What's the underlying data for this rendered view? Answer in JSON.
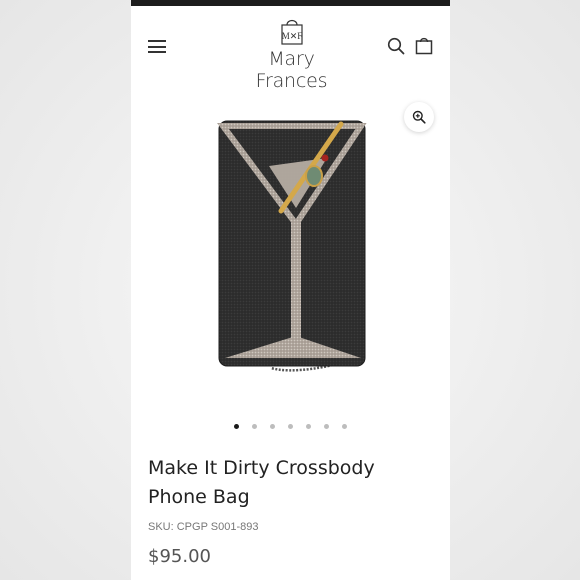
{
  "brand": {
    "monogram": "M✕F",
    "name": "Mary Frances"
  },
  "header": {
    "menu_icon": "hamburger-menu-icon",
    "search_icon": "search-icon",
    "cart_icon": "shopping-bag-icon"
  },
  "gallery": {
    "zoom_icon": "zoom-in-icon",
    "image_count": 7,
    "active_index": 0
  },
  "product": {
    "title": "Make It Dirty Crossbody Phone Bag",
    "sku": "SKU: CPGP S001-893",
    "price": "$95.00"
  },
  "colors": {
    "status_bar": "#1d1d1d",
    "bag_body": "#2b2b2b",
    "bead_silver": "#b9afa6",
    "active_dot": "#1a1a1a",
    "inactive_dot": "#bdbdbd"
  }
}
